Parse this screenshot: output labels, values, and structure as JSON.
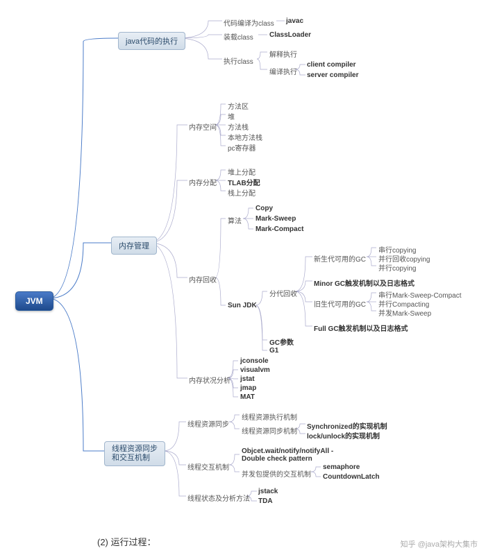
{
  "root": "JVM",
  "branches": {
    "b1": "java代码的执行",
    "b2": "内存管理",
    "b3": "线程资源同步\n和交互机制"
  },
  "b1": {
    "n1": "代码编译为class",
    "n1a": "javac",
    "n2": "装载class",
    "n2a": "ClassLoader",
    "n3": "执行class",
    "n3a": "解释执行",
    "n3b": "编译执行",
    "n3b1": "client compiler",
    "n3b2": "server compiler"
  },
  "b2": {
    "s1": "内存空间",
    "s1a": "方法区",
    "s1b": "堆",
    "s1c": "方法栈",
    "s1d": "本地方法栈",
    "s1e": "pc寄存器",
    "s2": "内存分配",
    "s2a": "堆上分配",
    "s2b": "TLAB分配",
    "s2c": "栈上分配",
    "s3": "内存回收",
    "s3a": "算法",
    "s3a1": "Copy",
    "s3a2": "Mark-Sweep",
    "s3a3": "Mark-Compact",
    "s3b": "Sun JDK",
    "s3b1": "分代回收",
    "s3b1a": "新生代可用的GC",
    "s3b1a1": "串行copying",
    "s3b1a2": "并行回收copying",
    "s3b1a3": "并行copying",
    "s3b1b": "Minor GC触发机制以及日志格式",
    "s3b1c": "旧生代可用的GC",
    "s3b1c1": "串行Mark-Sweep-Compact",
    "s3b1c2": "并行Compacting",
    "s3b1c3": "并发Mark-Sweep",
    "s3b1d": "Full GC触发机制以及日志格式",
    "s3b2": "GC参数",
    "s3b3": "G1",
    "s4": "内存状况分析",
    "s4a": "jconsole",
    "s4b": "visualvm",
    "s4c": "jstat",
    "s4d": "jmap",
    "s4e": "MAT"
  },
  "b3": {
    "t1": "线程资源同步",
    "t1a": "线程资源执行机制",
    "t1b": "线程资源同步机制",
    "t1b1": "Synchronized的实现机制",
    "t1b2": "lock/unlock的实现机制",
    "t2": "线程交互机制",
    "t2a": "Objcet.wait/notify/notifyAll - Double check pattern",
    "t2b": "并发包提供的交互机制",
    "t2b1": "semaphore",
    "t2b2": "CountdownLatch",
    "t3": "线程状态及分析方法",
    "t3a": "jstack",
    "t3b": "TDA"
  },
  "caption": "(2) 运行过程：",
  "watermark": "知乎 @java架构大集市"
}
